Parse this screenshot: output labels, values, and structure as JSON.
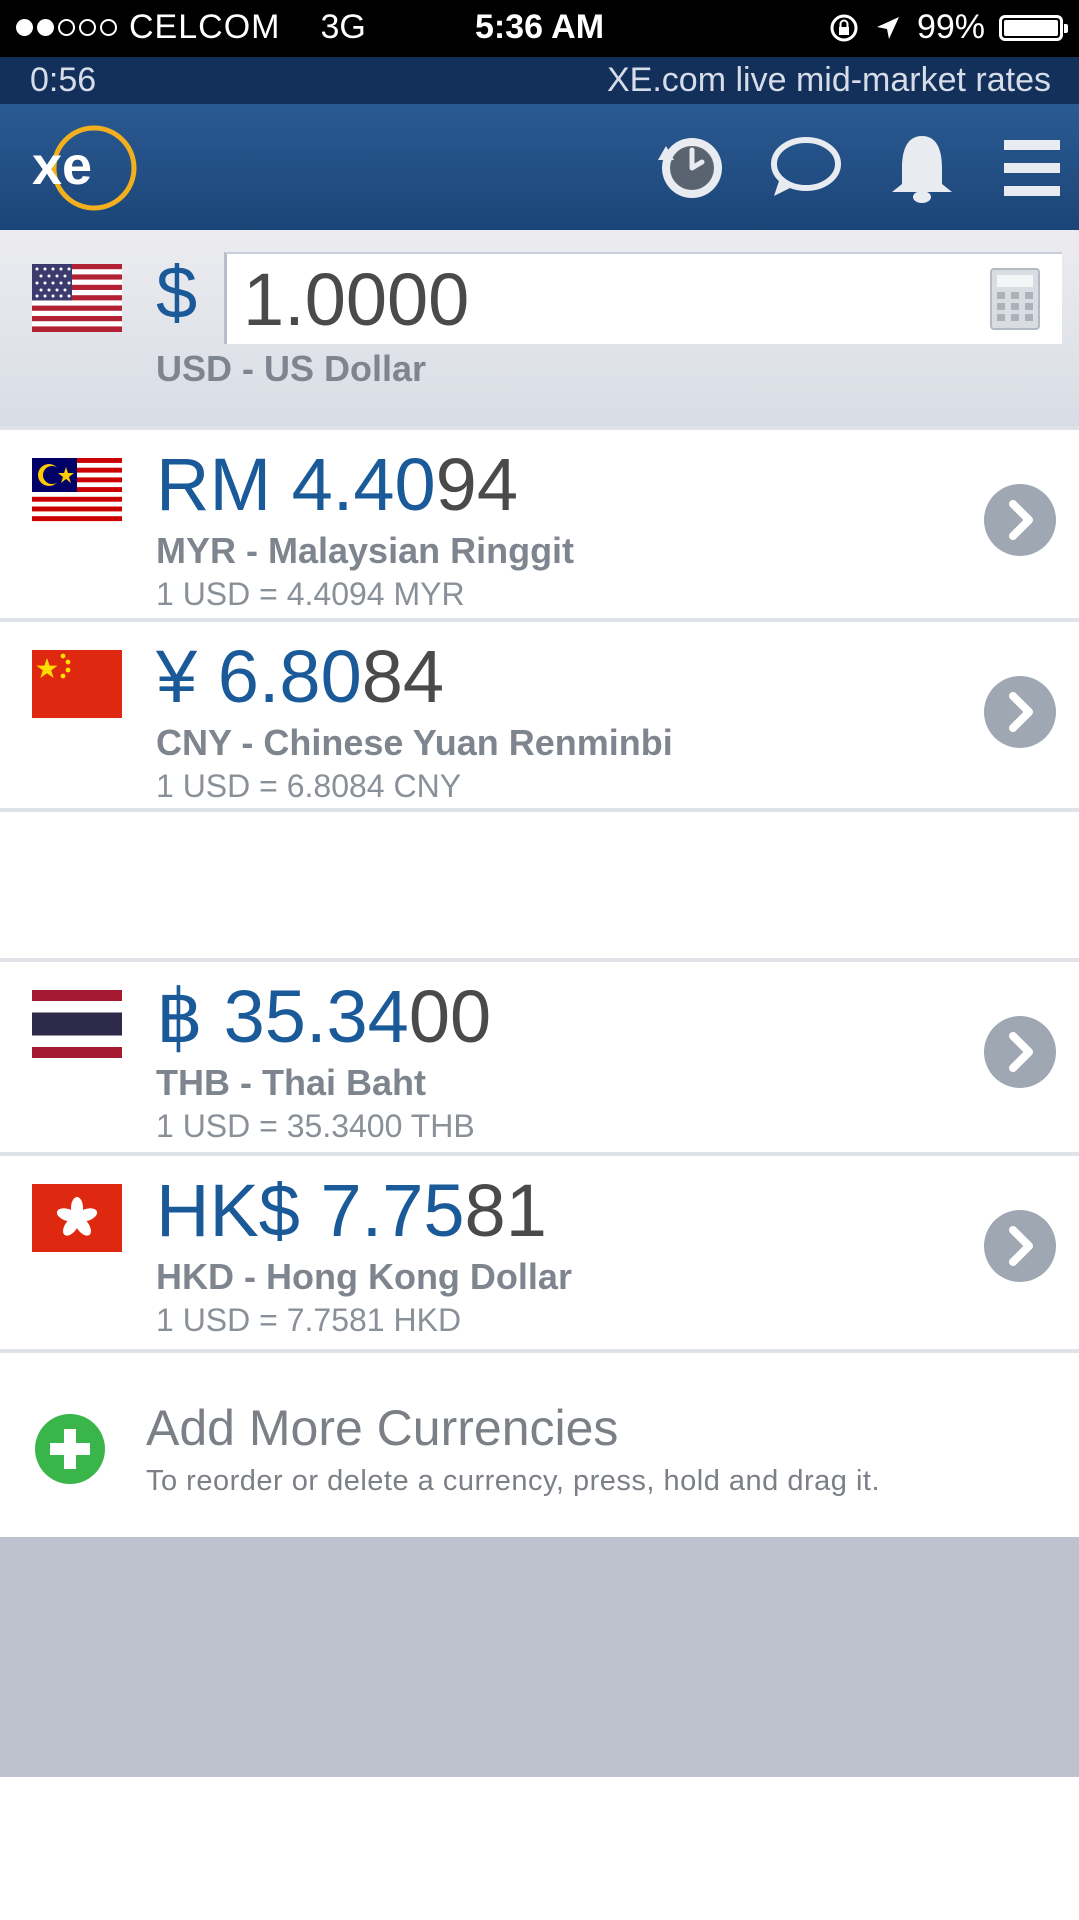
{
  "status_bar": {
    "carrier": "CELCOM",
    "network": "3G",
    "time": "5:36 AM",
    "battery": "99%",
    "battery_level": 0.99
  },
  "sub_bar": {
    "timer": "0:56",
    "note": "XE.com live mid-market rates"
  },
  "header": {
    "logo_text": "xe",
    "icons": [
      "history-clock-icon",
      "chat-bubble-icon",
      "bell-icon",
      "menu-icon"
    ]
  },
  "base": {
    "symbol": "$",
    "amount": "1.0000",
    "name": "USD - US Dollar",
    "flag": "us-flag-icon"
  },
  "currencies": [
    {
      "symbol_value": "RM 4.40",
      "value_dim": "94",
      "name": "MYR - Malaysian Ringgit",
      "rate": "1 USD = 4.4094 MYR",
      "flag": "malaysia-flag-icon"
    },
    {
      "symbol_value": "¥ 6.80",
      "value_dim": "84",
      "name": "CNY - Chinese Yuan Renminbi",
      "rate": "1 USD = 6.8084 CNY",
      "flag": "china-flag-icon"
    },
    {
      "symbol_value": "฿ 35.34",
      "value_dim": "00",
      "name": "THB - Thai Baht",
      "rate": "1 USD = 35.3400 THB",
      "flag": "thailand-flag-icon"
    },
    {
      "symbol_value": "HK$ 7.75",
      "value_dim": "81",
      "name": "HKD - Hong Kong Dollar",
      "rate": "1 USD = 7.7581 HKD",
      "flag": "hong-kong-flag-icon"
    }
  ],
  "add_more": {
    "title": "Add More Currencies",
    "hint": "To reorder or delete a currency, press, hold and drag it."
  },
  "colors": {
    "header": "#1b4578",
    "accent": "#1a5a99",
    "add": "#3ab54a",
    "logo_ring": "#f2b01e"
  }
}
